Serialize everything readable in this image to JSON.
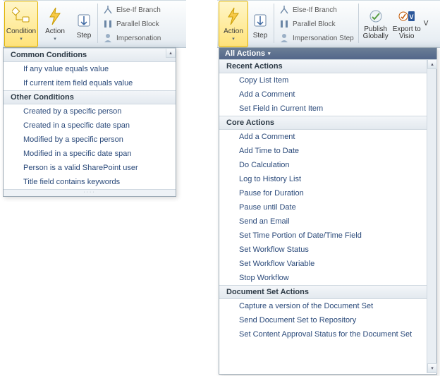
{
  "left": {
    "ribbon": {
      "condition": "Condition",
      "action": "Action",
      "step": "Step",
      "elseif": "Else-If Branch",
      "parallel": "Parallel Block",
      "impersonation": "Impersonation"
    },
    "panel": {
      "sections": [
        {
          "title": "Common Conditions",
          "items": [
            "If any value equals value",
            "If current item field equals value"
          ]
        },
        {
          "title": "Other Conditions",
          "items": [
            "Created by a specific person",
            "Created in a specific date span",
            "Modified by a specific person",
            "Modified in a specific date span",
            "Person is a valid SharePoint user",
            "Title field contains keywords"
          ]
        }
      ]
    }
  },
  "right": {
    "ribbon": {
      "action": "Action",
      "step": "Step",
      "elseif": "Else-If Branch",
      "parallel": "Parallel Block",
      "impersonation": "Impersonation Step",
      "publish_globally": "Publish Globally",
      "export_visio": "Export to Visio",
      "v_frag": "V"
    },
    "panel": {
      "header": "All Actions",
      "sections": [
        {
          "title": "Recent Actions",
          "items": [
            "Copy List Item",
            "Add a Comment",
            "Set Field in Current Item"
          ]
        },
        {
          "title": "Core Actions",
          "items": [
            "Add a Comment",
            "Add Time to Date",
            "Do Calculation",
            "Log to History List",
            "Pause for Duration",
            "Pause until Date",
            "Send an Email",
            "Set Time Portion of Date/Time Field",
            "Set Workflow Status",
            "Set Workflow Variable",
            "Stop Workflow"
          ]
        },
        {
          "title": "Document Set Actions",
          "items": [
            "Capture a version of the Document Set",
            "Send Document Set to Repository",
            "Set Content Approval Status for the Document Set"
          ]
        }
      ]
    }
  }
}
